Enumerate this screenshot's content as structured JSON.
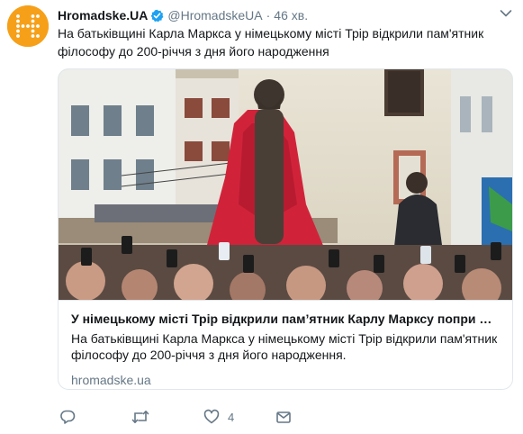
{
  "tweet": {
    "display_name": "Hromadske.UA",
    "handle": "@HromadskeUA",
    "separator": "·",
    "time": "46 хв.",
    "text": "На батьківщині Карла Маркса у німецькому місті Трір відкрили пам'ятник філософу до 200-річчя з дня його народження"
  },
  "card": {
    "title": "У німецькому місті Трір відкрили пам’ятник Карлу Марксу попри п...",
    "description": "На батьківщині Карла Маркса у німецькому місті Трір відкрили пам'ятник філософу до 200-річчя з дня його народження.",
    "domain": "hromadske.ua"
  },
  "actions": {
    "like_count": "4"
  },
  "colors": {
    "brand": "#f6a01a",
    "verified": "#1da1f2",
    "secondary_text": "#657786",
    "border": "#e1e8ed"
  },
  "icons": {
    "avatar": "hromadske-logo-icon",
    "verified": "verified-badge-icon",
    "menu": "chevron-down-icon",
    "reply": "reply-icon",
    "retweet": "retweet-icon",
    "like": "heart-icon",
    "dm": "envelope-icon"
  }
}
